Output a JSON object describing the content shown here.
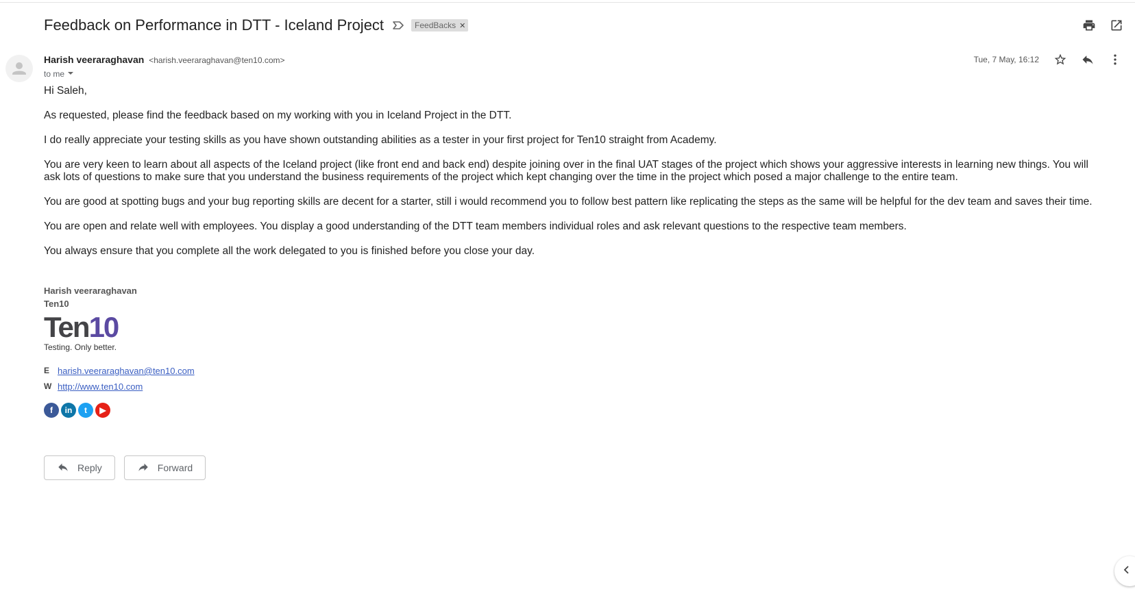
{
  "email": {
    "subject": "Feedback on Performance in DTT - Iceland Project",
    "label": "FeedBacks",
    "sender_name": "Harish veeraraghavan",
    "sender_email": "<harish.veeraraghavan@ten10.com>",
    "recipient": "to me",
    "date": "Tue, 7 May, 16:12",
    "body": [
      "Hi Saleh,",
      "As requested, please find the feedback based on my working with you in Iceland Project in the DTT.",
      "I do really appreciate your testing skills as you have shown outstanding abilities as a tester in your first project for Ten10 straight from Academy.",
      "You are very keen to learn about all aspects of the Iceland project (like front end and back end) despite joining over in the final UAT stages of the project which shows your aggressive interests in learning new things. You will ask lots of questions to make sure that you understand the business requirements of the project which kept changing over the time in the project which posed a major challenge to the entire team.",
      "You are good at spotting bugs and your bug reporting skills are decent for a starter, still i would recommend you to follow best pattern like replicating the steps as the same will be helpful for the dev team and saves their time.",
      "You are open and relate well with employees. You display a good understanding of the DTT team members individual roles and ask relevant questions to the respective team members.",
      "You always ensure that you complete all the work delegated to you is finished before you close your day."
    ]
  },
  "signature": {
    "name": "Harish veeraraghavan",
    "company": "Ten10",
    "logo_part1": "Ten",
    "logo_part2": "10",
    "tagline": "Testing. Only better.",
    "email_key": "E",
    "email": "harish.veeraraghavan@ten10.com",
    "web_key": "W",
    "web": "http://www.ten10.com",
    "brand_color": "#5b4aa2"
  },
  "social": [
    {
      "icon": "facebook-icon",
      "glyph": "f"
    },
    {
      "icon": "linkedin-icon",
      "glyph": "in"
    },
    {
      "icon": "twitter-icon",
      "glyph": "t"
    },
    {
      "icon": "youtube-icon",
      "glyph": "▶"
    }
  ],
  "actions": {
    "reply_label": "Reply",
    "forward_label": "Forward"
  },
  "icons": {
    "print": "print-icon",
    "open_new_window": "open-in-new-window-icon",
    "star": "star-icon",
    "reply": "reply-icon",
    "more": "more-vertical-icon",
    "importance": "importance-marker-icon"
  }
}
